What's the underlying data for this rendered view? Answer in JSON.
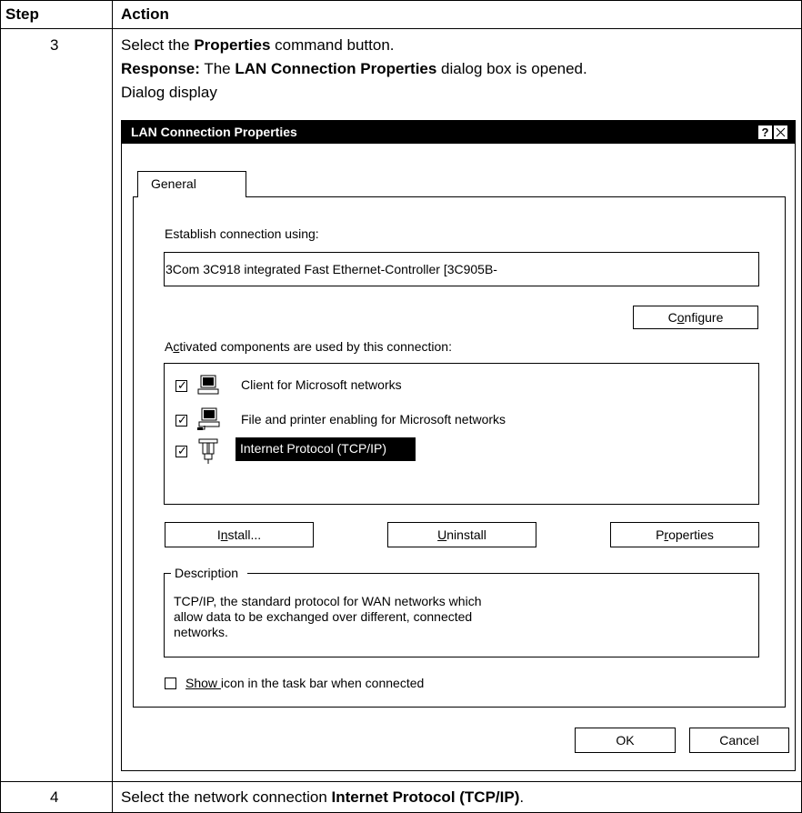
{
  "table": {
    "header_step": "Step",
    "header_action": "Action",
    "row3": {
      "step": "3",
      "line1_pre": "Select the ",
      "line1_bold": "Properties",
      "line1_post": " command button.",
      "line2_bold1": "Response:",
      "line2_mid": " The ",
      "line2_bold2": "LAN Connection Properties",
      "line2_post": " dialog box is opened.",
      "line3": "Dialog display"
    },
    "row4": {
      "step": "4",
      "pre": "Select the network connection ",
      "bold": "Internet Protocol (TCP/IP)",
      "post": "."
    }
  },
  "dialog": {
    "title": "LAN Connection Properties",
    "help_btn": "?",
    "close_btn": "×",
    "tab_general": "General",
    "establish_label": "Establish connection using:",
    "adapter_value": "3Com 3C918 integrated Fast Ethernet-Controller [3C905B-",
    "configure": {
      "pre": "C",
      "accel": "o",
      "post": "nfigure"
    },
    "components_label": {
      "pre": "A",
      "accel": "c",
      "post": "tivated components are used by this connection:"
    },
    "components": [
      {
        "label": "Client for Microsoft networks",
        "checked": true,
        "icon": "client-computer-icon"
      },
      {
        "label": "File and printer enabling for Microsoft networks",
        "checked": true,
        "icon": "file-printer-sharing-icon"
      },
      {
        "label": "Internet Protocol (TCP/IP)",
        "checked": true,
        "icon": "network-protocol-icon",
        "selected": true
      }
    ],
    "install": {
      "pre": "I",
      "accel": "n",
      "post": "stall..."
    },
    "uninstall": {
      "pre": "",
      "accel": "U",
      "post": "ninstall"
    },
    "properties": {
      "pre": "P",
      "accel": "r",
      "post": "operties"
    },
    "description_legend": "Description",
    "description_text": [
      "TCP/IP, the standard protocol for WAN networks which",
      "allow data to be exchanged over different, connected",
      "networks."
    ],
    "show_icon": {
      "accel": "Show ",
      "post": "icon in the task bar when connected",
      "checked": false
    },
    "ok": "OK",
    "cancel": "Cancel"
  }
}
